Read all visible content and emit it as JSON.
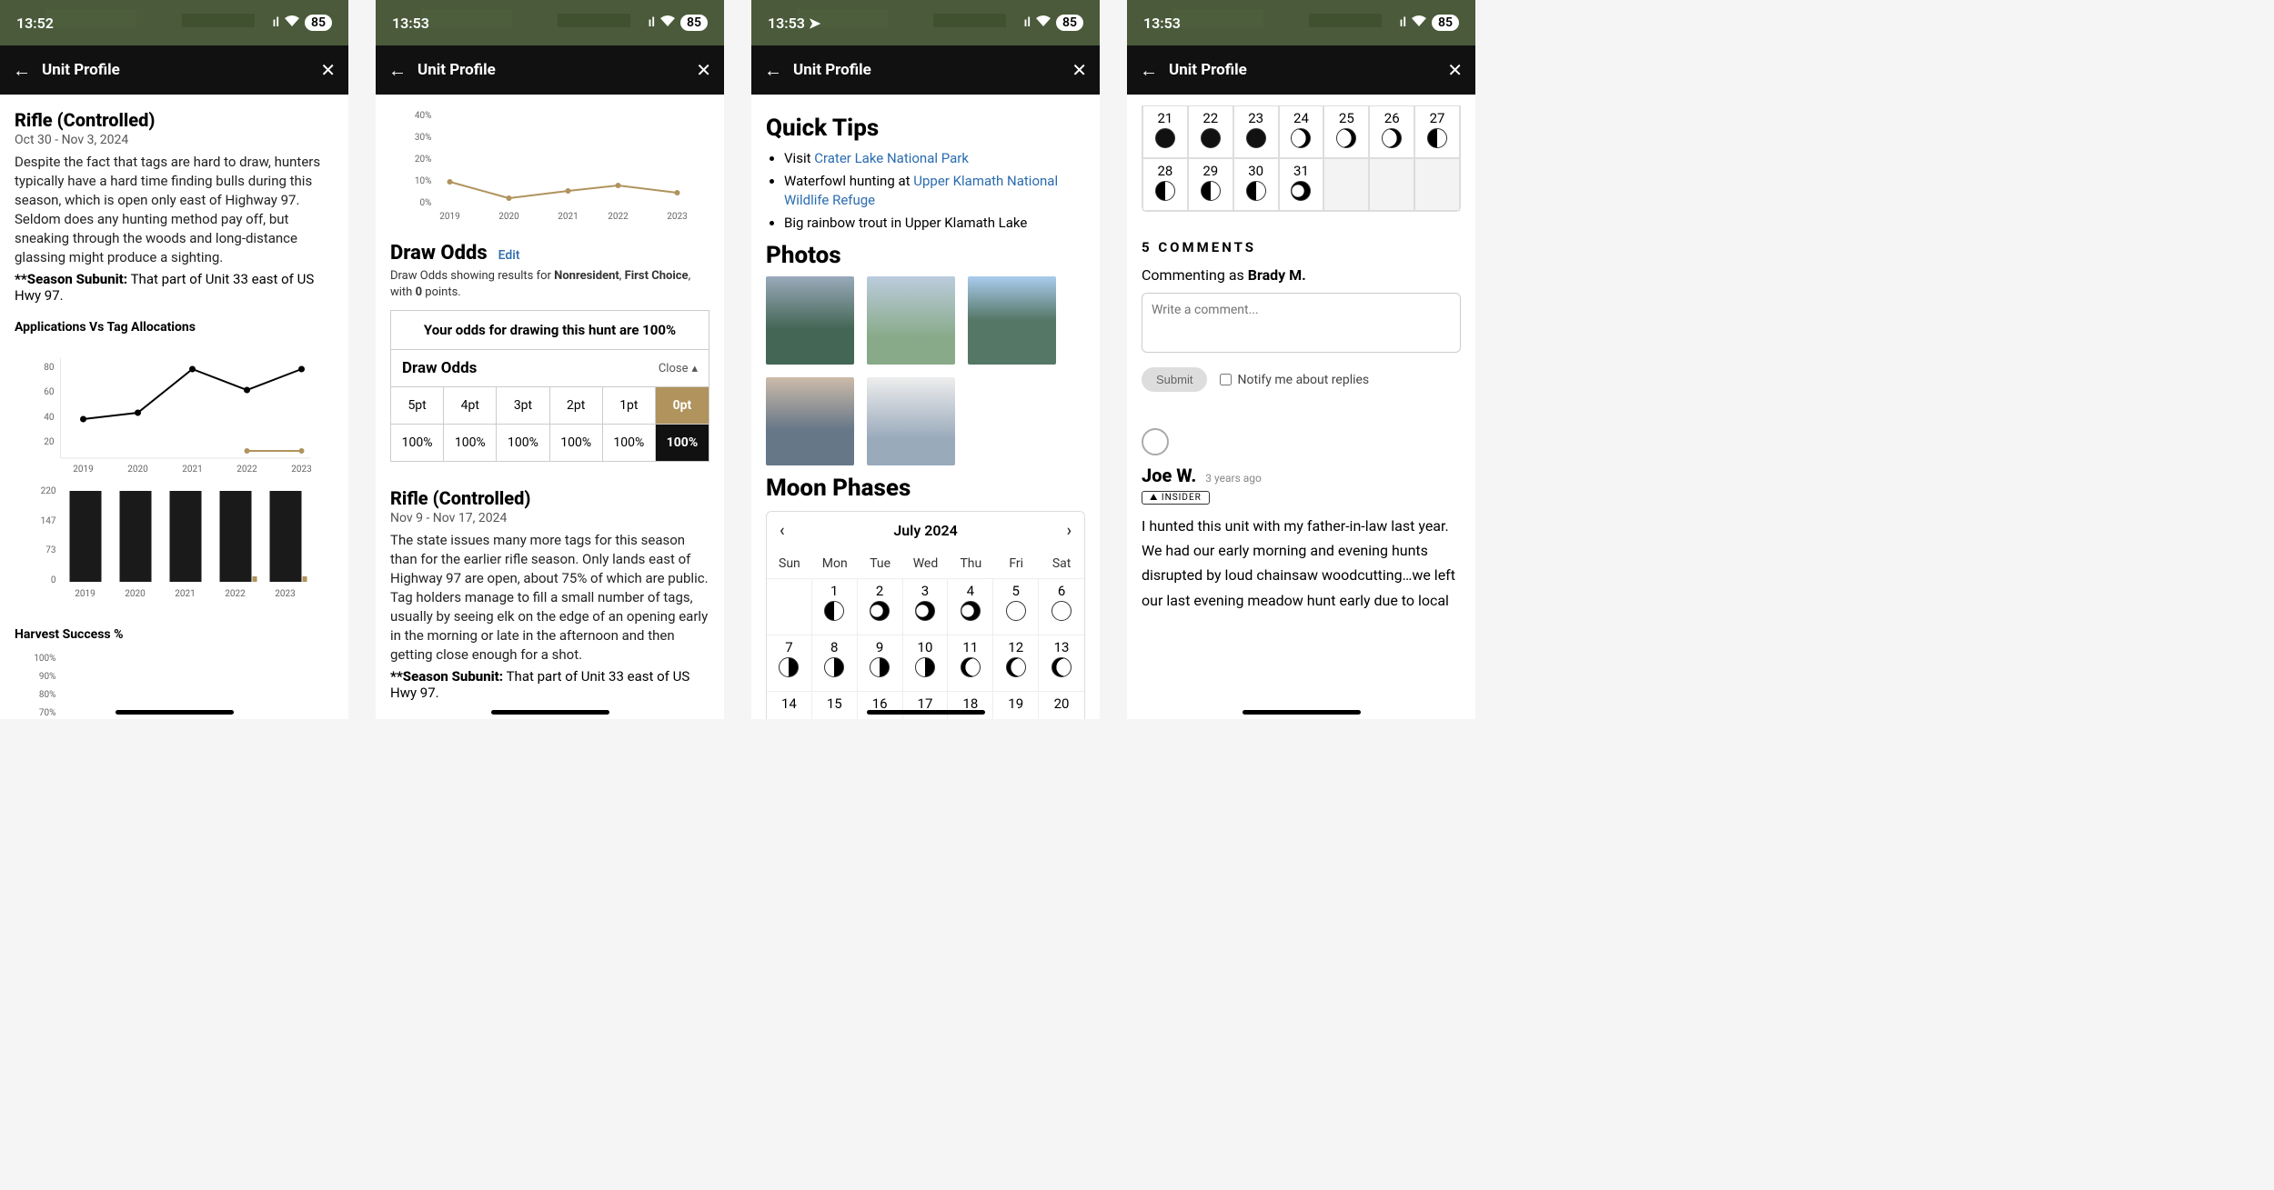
{
  "status": {
    "time1": "13:52",
    "time2": "13:53",
    "battery": "85",
    "signal": "••ıl",
    "wifi": "⊕"
  },
  "nav": {
    "title": "Unit Profile"
  },
  "s1": {
    "title": "Rifle (Controlled)",
    "dates": "Oct 30 - Nov 3, 2024",
    "body": "Despite the fact that tags are hard to draw, hunters typically have a hard time finding bulls during this season, which is open only east of Highway 97. Seldom does any hunting method pay off, but sneaking through the woods and long-distance glassing might produce a sighting.",
    "subunit_label": "**Season Subunit:",
    "subunit_text": "That part of Unit 33 east of US Hwy 97.",
    "sec_apps": "Applications Vs Tag Allocations",
    "sec_harvest": "Harvest Success %"
  },
  "s2": {
    "draw_title": "Draw Odds",
    "edit": "Edit",
    "caption_pre": "Draw Odds showing results for ",
    "caption_b1": "Nonresident",
    "caption_sep": ", ",
    "caption_b2": "First Choice",
    "caption_mid": ", with ",
    "caption_b3": "0",
    "caption_end": " points.",
    "banner": "Your odds for drawing this hunt are 100%",
    "table_label": "Draw Odds",
    "close": "Close",
    "pts": [
      "5pt",
      "4pt",
      "3pt",
      "2pt",
      "1pt",
      "0pt"
    ],
    "pcts": [
      "100%",
      "100%",
      "100%",
      "100%",
      "100%",
      "100%"
    ],
    "title2": "Rifle (Controlled)",
    "dates2": "Nov 9 - Nov 17, 2024",
    "body2": "The state issues many more tags for this season than for the earlier rifle season. Only lands east of Highway 97 are open, about 75% of which are public. Tag holders manage to fill a small number of tags, usually by seeing elk on the edge of an opening early in the morning or late in the afternoon and then getting close enough for a shot.",
    "subunit_label": "**Season Subunit:",
    "subunit_text": "That part of Unit 33 east of US Hwy 97."
  },
  "s3": {
    "quick_tips": "Quick Tips",
    "tip1_pre": "Visit ",
    "tip1_link": "Crater Lake National Park",
    "tip2_pre": "Waterfowl hunting at ",
    "tip2_link": "Upper Klamath National Wildlife Refuge",
    "tip3": "Big rainbow trout in Upper Klamath Lake",
    "photos": "Photos",
    "moon": "Moon Phases",
    "month": "July 2024",
    "dow": [
      "Sun",
      "Mon",
      "Tue",
      "Wed",
      "Thu",
      "Fri",
      "Sat"
    ],
    "days_r1": [
      "",
      "1",
      "2",
      "3",
      "4",
      "5",
      "6"
    ],
    "days_r2": [
      "7",
      "8",
      "9",
      "10",
      "11",
      "12",
      "13"
    ],
    "days_r3": [
      "14",
      "15",
      "16",
      "17",
      "18",
      "19",
      "20"
    ]
  },
  "s4": {
    "row1": [
      "21",
      "22",
      "23",
      "24",
      "25",
      "26",
      "27"
    ],
    "row2": [
      "28",
      "29",
      "30",
      "31",
      "",
      "",
      ""
    ],
    "comments_h": "5 COMMENTS",
    "commenting_as_pre": "Commenting as ",
    "commenting_as_name": "Brady M.",
    "placeholder": "Write a comment...",
    "submit": "Submit",
    "notify": "Notify me about replies",
    "commenter": "Joe W.",
    "timeago": "3 years ago",
    "badge": "⛰ INSIDER",
    "comment_text": "I hunted this unit with my father-in-law last year. We had our early morning and evening hunts disrupted by loud chainsaw woodcutting…we left our last evening meadow hunt early due to local"
  },
  "chart_data": [
    {
      "type": "line",
      "title": "Applications Vs Tag Allocations (line series)",
      "categories": [
        "2019",
        "2020",
        "2021",
        "2022",
        "2023"
      ],
      "values": [
        41,
        47,
        82,
        64,
        82
      ],
      "ylim": [
        0,
        90
      ],
      "yticks": [
        20,
        40,
        60,
        80
      ]
    },
    {
      "type": "bar",
      "title": "Applications Vs Tag Allocations (bar series)",
      "categories": [
        "2019",
        "2020",
        "2021",
        "2022",
        "2023"
      ],
      "series": [
        {
          "name": "dark",
          "values": [
            220,
            220,
            220,
            220,
            220
          ]
        },
        {
          "name": "gold",
          "values": [
            0,
            0,
            0,
            8,
            8
          ]
        }
      ],
      "ylim": [
        0,
        220
      ],
      "yticks": [
        0,
        73,
        147,
        220
      ]
    },
    {
      "type": "line",
      "title": "Harvest Success %",
      "categories": [],
      "values": [],
      "ylim": [
        0,
        100
      ],
      "yticks": [
        70,
        80,
        90,
        100
      ]
    },
    {
      "type": "line",
      "title": "Draw Odds trend",
      "categories": [
        "2019",
        "2020",
        "2021",
        "2022",
        "2023"
      ],
      "values": [
        10,
        5,
        9,
        10,
        8
      ],
      "ylim": [
        0,
        40
      ],
      "yticks": [
        0,
        10,
        20,
        30,
        40
      ],
      "color": "#b0935d"
    }
  ]
}
